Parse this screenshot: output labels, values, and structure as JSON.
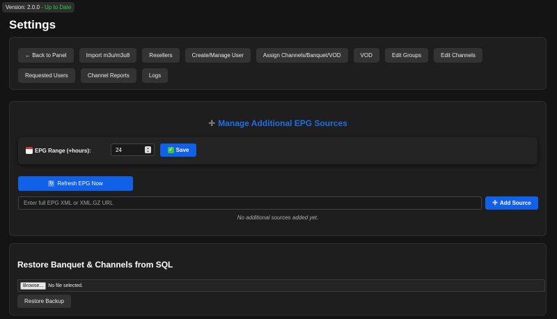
{
  "version": {
    "label": "Version: 2.0.0",
    "status": " - Up to Date",
    "status_color": "#2ecc40"
  },
  "page_title": "Settings",
  "nav": {
    "row1": [
      "← Back to Panel",
      "Import m3u/m3u8",
      "Resellers",
      "Create/Manage User",
      "Assign Channels/Banquet/VOD",
      "VOD",
      "Edit Groups",
      "Edit Channels"
    ],
    "row2": [
      "Requested Users",
      "Channel Reports",
      "Logs"
    ]
  },
  "epg": {
    "title_icon": "plus-icon",
    "title": "Manage Additional EPG Sources",
    "range_label": "EPG Range (+hours):",
    "range_value": "24",
    "save_label": "Save",
    "refresh_label": "Refresh EPG Now",
    "url_placeholder": "Enter full EPG XML or XML.GZ URL",
    "add_source_label": "Add Source",
    "empty_note": "No additional sources added yet."
  },
  "restore": {
    "title": "Restore Banquet & Channels from SQL",
    "browse_label": "Browse...",
    "file_status": "No file selected.",
    "restore_label": "Restore Backup"
  },
  "colors": {
    "accent": "#1160e8",
    "title_accent": "#1e6fe6",
    "background": "#141414",
    "panel": "#1e1e1e"
  }
}
